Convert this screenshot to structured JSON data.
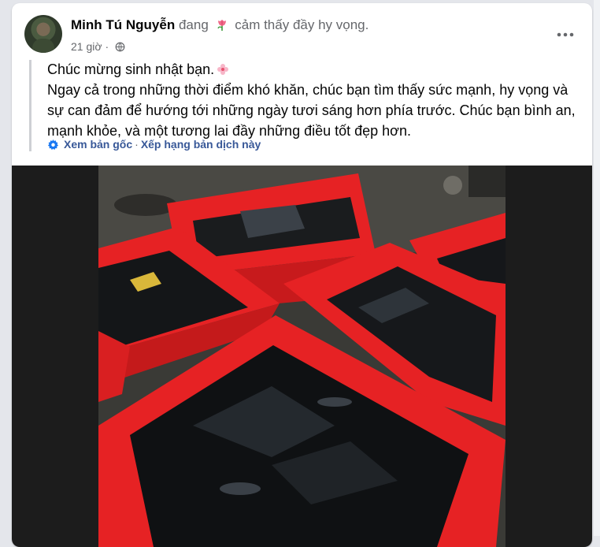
{
  "post": {
    "author": "Minh Tú Nguyễn",
    "feeling_prefix": "đang",
    "feeling_text": "cảm thấy đầy hy vọng.",
    "time": "21 giờ",
    "separator": "·",
    "line1": "Chúc mừng sinh nhật bạn.",
    "line2": "Ngay cả trong những thời điểm khó khăn, chúc bạn tìm thấy sức mạnh, hy vọng và sự can đảm để hướng tới những ngày tươi sáng hơn phía trước. Chúc bạn bình an, mạnh khỏe, và một tương lai đầy những điều tốt đẹp hơn.",
    "see_original": "Xem bản gốc",
    "rate_translation": "Xếp hạng bản dịch này"
  },
  "icons": {
    "feeling": "tulip-icon",
    "privacy": "globe-icon",
    "more": "more-horizontal-icon",
    "translate": "gear-icon",
    "emoji": "flower-icon"
  },
  "colors": {
    "link": "#385898",
    "muted": "#65676b",
    "basket_red": "#e62224"
  }
}
